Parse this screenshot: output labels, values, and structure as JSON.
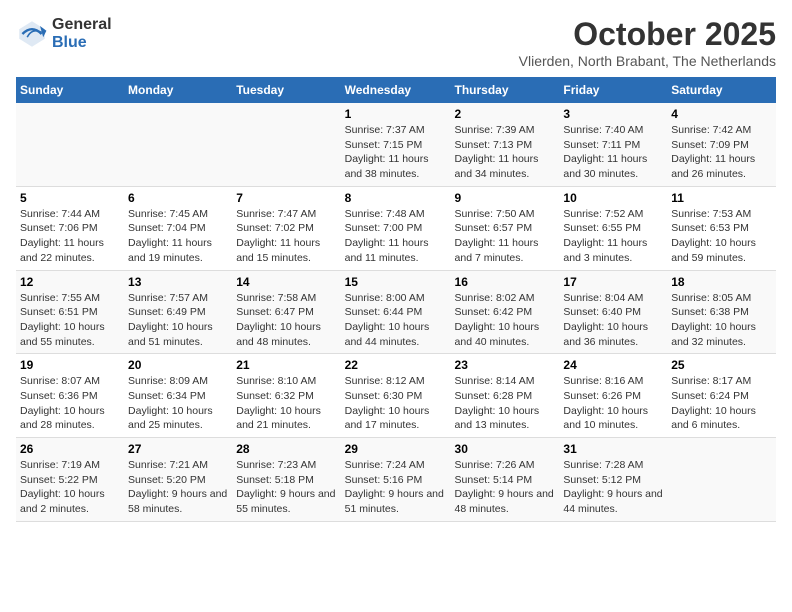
{
  "logo": {
    "general": "General",
    "blue": "Blue"
  },
  "title": "October 2025",
  "subtitle": "Vlierden, North Brabant, The Netherlands",
  "weekdays": [
    "Sunday",
    "Monday",
    "Tuesday",
    "Wednesday",
    "Thursday",
    "Friday",
    "Saturday"
  ],
  "weeks": [
    [
      {
        "day": "",
        "info": ""
      },
      {
        "day": "",
        "info": ""
      },
      {
        "day": "",
        "info": ""
      },
      {
        "day": "1",
        "info": "Sunrise: 7:37 AM\nSunset: 7:15 PM\nDaylight: 11 hours and 38 minutes."
      },
      {
        "day": "2",
        "info": "Sunrise: 7:39 AM\nSunset: 7:13 PM\nDaylight: 11 hours and 34 minutes."
      },
      {
        "day": "3",
        "info": "Sunrise: 7:40 AM\nSunset: 7:11 PM\nDaylight: 11 hours and 30 minutes."
      },
      {
        "day": "4",
        "info": "Sunrise: 7:42 AM\nSunset: 7:09 PM\nDaylight: 11 hours and 26 minutes."
      }
    ],
    [
      {
        "day": "5",
        "info": "Sunrise: 7:44 AM\nSunset: 7:06 PM\nDaylight: 11 hours and 22 minutes."
      },
      {
        "day": "6",
        "info": "Sunrise: 7:45 AM\nSunset: 7:04 PM\nDaylight: 11 hours and 19 minutes."
      },
      {
        "day": "7",
        "info": "Sunrise: 7:47 AM\nSunset: 7:02 PM\nDaylight: 11 hours and 15 minutes."
      },
      {
        "day": "8",
        "info": "Sunrise: 7:48 AM\nSunset: 7:00 PM\nDaylight: 11 hours and 11 minutes."
      },
      {
        "day": "9",
        "info": "Sunrise: 7:50 AM\nSunset: 6:57 PM\nDaylight: 11 hours and 7 minutes."
      },
      {
        "day": "10",
        "info": "Sunrise: 7:52 AM\nSunset: 6:55 PM\nDaylight: 11 hours and 3 minutes."
      },
      {
        "day": "11",
        "info": "Sunrise: 7:53 AM\nSunset: 6:53 PM\nDaylight: 10 hours and 59 minutes."
      }
    ],
    [
      {
        "day": "12",
        "info": "Sunrise: 7:55 AM\nSunset: 6:51 PM\nDaylight: 10 hours and 55 minutes."
      },
      {
        "day": "13",
        "info": "Sunrise: 7:57 AM\nSunset: 6:49 PM\nDaylight: 10 hours and 51 minutes."
      },
      {
        "day": "14",
        "info": "Sunrise: 7:58 AM\nSunset: 6:47 PM\nDaylight: 10 hours and 48 minutes."
      },
      {
        "day": "15",
        "info": "Sunrise: 8:00 AM\nSunset: 6:44 PM\nDaylight: 10 hours and 44 minutes."
      },
      {
        "day": "16",
        "info": "Sunrise: 8:02 AM\nSunset: 6:42 PM\nDaylight: 10 hours and 40 minutes."
      },
      {
        "day": "17",
        "info": "Sunrise: 8:04 AM\nSunset: 6:40 PM\nDaylight: 10 hours and 36 minutes."
      },
      {
        "day": "18",
        "info": "Sunrise: 8:05 AM\nSunset: 6:38 PM\nDaylight: 10 hours and 32 minutes."
      }
    ],
    [
      {
        "day": "19",
        "info": "Sunrise: 8:07 AM\nSunset: 6:36 PM\nDaylight: 10 hours and 28 minutes."
      },
      {
        "day": "20",
        "info": "Sunrise: 8:09 AM\nSunset: 6:34 PM\nDaylight: 10 hours and 25 minutes."
      },
      {
        "day": "21",
        "info": "Sunrise: 8:10 AM\nSunset: 6:32 PM\nDaylight: 10 hours and 21 minutes."
      },
      {
        "day": "22",
        "info": "Sunrise: 8:12 AM\nSunset: 6:30 PM\nDaylight: 10 hours and 17 minutes."
      },
      {
        "day": "23",
        "info": "Sunrise: 8:14 AM\nSunset: 6:28 PM\nDaylight: 10 hours and 13 minutes."
      },
      {
        "day": "24",
        "info": "Sunrise: 8:16 AM\nSunset: 6:26 PM\nDaylight: 10 hours and 10 minutes."
      },
      {
        "day": "25",
        "info": "Sunrise: 8:17 AM\nSunset: 6:24 PM\nDaylight: 10 hours and 6 minutes."
      }
    ],
    [
      {
        "day": "26",
        "info": "Sunrise: 7:19 AM\nSunset: 5:22 PM\nDaylight: 10 hours and 2 minutes."
      },
      {
        "day": "27",
        "info": "Sunrise: 7:21 AM\nSunset: 5:20 PM\nDaylight: 9 hours and 58 minutes."
      },
      {
        "day": "28",
        "info": "Sunrise: 7:23 AM\nSunset: 5:18 PM\nDaylight: 9 hours and 55 minutes."
      },
      {
        "day": "29",
        "info": "Sunrise: 7:24 AM\nSunset: 5:16 PM\nDaylight: 9 hours and 51 minutes."
      },
      {
        "day": "30",
        "info": "Sunrise: 7:26 AM\nSunset: 5:14 PM\nDaylight: 9 hours and 48 minutes."
      },
      {
        "day": "31",
        "info": "Sunrise: 7:28 AM\nSunset: 5:12 PM\nDaylight: 9 hours and 44 minutes."
      },
      {
        "day": "",
        "info": ""
      }
    ]
  ]
}
